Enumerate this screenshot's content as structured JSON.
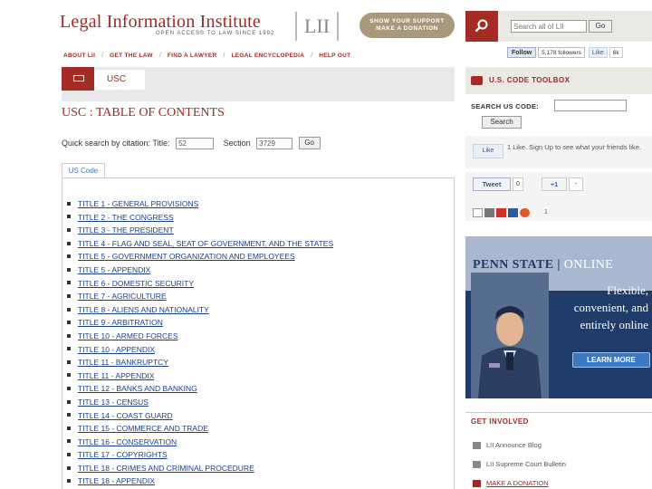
{
  "header": {
    "site_title": "Legal Information Institute",
    "tagline": "OPEN ACCESS TO LAW SINCE 1992",
    "logo_text": "LII",
    "donate_line1": "SHOW YOUR SUPPORT",
    "donate_line2": "MAKE A DONATION",
    "search_placeholder": "Search all of LII",
    "search_go": "Go"
  },
  "nav": {
    "items": [
      "ABOUT LII",
      "GET THE LAW",
      "FIND A LAWYER",
      "LEGAL ENCYCLOPEDIA",
      "HELP OUT"
    ],
    "separator": "/"
  },
  "social": {
    "follow": "Follow",
    "followers": "5,178 followers",
    "like": "Like",
    "like_count": "6k"
  },
  "main": {
    "section_tab": "USC",
    "page_title": "USC : TABLE OF CONTENTS",
    "quick_search_label": "Quick search by citation: Title:",
    "title_value": "52",
    "section_label": "Section",
    "section_value": "3729",
    "go": "Go",
    "code_tab": "US Code",
    "toc": [
      "TITLE 1 - GENERAL PROVISIONS",
      "TITLE 2 - THE CONGRESS",
      "TITLE 3 - THE PRESIDENT",
      "TITLE 4 - FLAG AND SEAL, SEAT OF GOVERNMENT, AND THE STATES",
      "TITLE 5 - GOVERNMENT ORGANIZATION AND EMPLOYEES",
      "TITLE 5 - APPENDIX",
      "TITLE 6 - DOMESTIC SECURITY",
      "TITLE 7 - AGRICULTURE",
      "TITLE 8 - ALIENS AND NATIONALITY",
      "TITLE 9 - ARBITRATION",
      "TITLE 10 - ARMED FORCES",
      "TITLE 10 - APPENDIX",
      "TITLE 11 - BANKRUPTCY",
      "TITLE 11 - APPENDIX",
      "TITLE 12 - BANKS AND BANKING",
      "TITLE 13 - CENSUS",
      "TITLE 14 - COAST GUARD",
      "TITLE 15 - COMMERCE AND TRADE",
      "TITLE 16 - CONSERVATION",
      "TITLE 17 - COPYRIGHTS",
      "TITLE 18 - CRIMES AND CRIMINAL PROCEDURE",
      "TITLE 18 - APPENDIX"
    ]
  },
  "sidebar": {
    "toolbox_title": "U.S. CODE TOOLBOX",
    "search_label": "SEARCH US CODE:",
    "search_button": "Search",
    "like_button": "Like",
    "like_text": "1 Like. Sign Up to see what your friends like.",
    "tweet": "Tweet",
    "tweet_count": "0",
    "gplus": "+1",
    "gplus_count": "-",
    "share_count": "1"
  },
  "ad": {
    "brand_left": "PENN STATE",
    "brand_right": "ONLINE",
    "headline": [
      "Flexible,",
      "convenient, and",
      "entirely online"
    ],
    "cta": "LEARN MORE"
  },
  "involved": {
    "title": "GET INVOLVED",
    "items": [
      "LII Announce Blog",
      "LII Supreme Court Bulletin",
      "MAKE A DONATION"
    ]
  },
  "colors": {
    "brand_red": "#9c2a25",
    "link_blue": "#1a3f8a",
    "ad_navy": "#1f3c6a"
  }
}
